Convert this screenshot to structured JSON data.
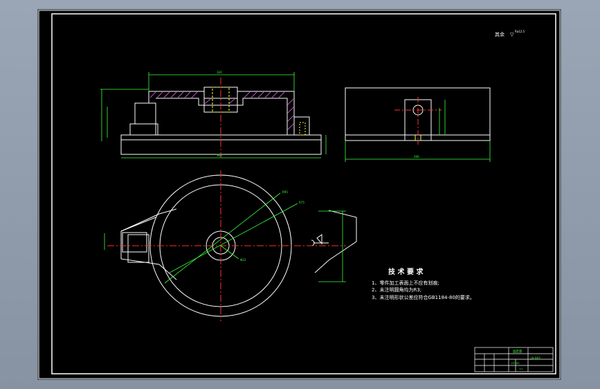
{
  "roughness_note": "其余",
  "roughness_symbol": "▽",
  "roughness_value": "Ra12.5",
  "tech_requirements": {
    "title": "技 术 要 求",
    "items": [
      "1、零件加工表面上不应有划痕;",
      "2、未注明圆角均为R3;",
      "3、未注明形状公差应符合GB1184-80的要求。"
    ]
  },
  "dimensions": {
    "front_width": "320",
    "front_base": "300",
    "side_width": "206",
    "dim_radius_large": "R95",
    "dim_radius_mid": "R75",
    "dim_bore": "Φ22"
  },
  "title_block": {
    "part_name": "固定座",
    "drawing_no": "JX-001",
    "material": "HT200",
    "scale": "1:1"
  },
  "colors": {
    "outline": "#ffffff",
    "dimension": "#3cff3c",
    "centerline": "#ff3030",
    "hatch": "#ff66ff",
    "hidden": "#ffff33",
    "frame": "#ffffff"
  }
}
